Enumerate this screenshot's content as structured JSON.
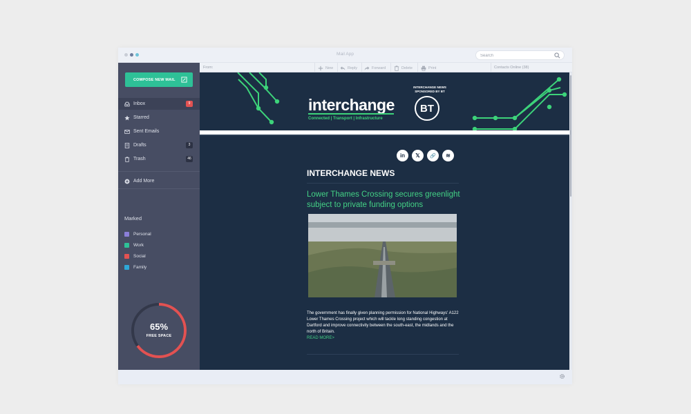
{
  "window": {
    "title": "Mail App",
    "dot_colors": [
      "#c9cdd6",
      "#6e7c9c",
      "#6fc3d9"
    ]
  },
  "search": {
    "placeholder": "Search"
  },
  "sidebar": {
    "compose_label": "COMPOSE NEW MAIL",
    "items": [
      {
        "label": "Inbox",
        "icon": "inbox-icon",
        "badge": "9",
        "badge_color": "#e25252",
        "active": true
      },
      {
        "label": "Starred",
        "icon": "star-icon",
        "badge": "",
        "active": false
      },
      {
        "label": "Sent Emails",
        "icon": "envelope-icon",
        "badge": "",
        "active": false
      },
      {
        "label": "Drafts",
        "icon": "draft-icon",
        "badge": "3",
        "badge_color": "#2d3244",
        "active": false
      },
      {
        "label": "Trash",
        "icon": "trash-icon",
        "badge": "46",
        "badge_color": "#2d3244",
        "active": false
      }
    ],
    "add_more_label": "Add More",
    "marked_title": "Marked",
    "tags": [
      {
        "label": "Personal",
        "color": "#8b7fd8"
      },
      {
        "label": "Work",
        "color": "#2ec197"
      },
      {
        "label": "Social",
        "color": "#e25252"
      },
      {
        "label": "Family",
        "color": "#2ea8d8"
      }
    ],
    "storage": {
      "percent_label": "65%",
      "free_fraction": 0.65,
      "caption": "FREE SPACE",
      "ring_color": "#e25252"
    }
  },
  "toolbar": {
    "from_label": "From:",
    "buttons": [
      {
        "label": "New",
        "icon": "plus-icon"
      },
      {
        "label": "Reply",
        "icon": "reply-icon"
      },
      {
        "label": "Forward",
        "icon": "forward-icon"
      },
      {
        "label": "Delete",
        "icon": "trash-icon"
      },
      {
        "label": "Print",
        "icon": "print-icon"
      }
    ],
    "contacts_label": "Contacts Online (38)"
  },
  "email": {
    "logo": "interchange",
    "tagline": "Connected | Transport | Infrastructure",
    "sponsor_line1": "INTERCHANGE NEWS",
    "sponsor_line2": "SPONSORED BY BT",
    "bt_logo": "BT",
    "social_icons": [
      "linkedin-icon",
      "x-icon",
      "link-icon",
      "spotify-icon"
    ],
    "social_labels": [
      "in",
      "𝕏",
      "🔗",
      "≋"
    ],
    "section_heading": "INTERCHANGE NEWS",
    "article_title": "Lower Thames Crossing secures greenlight subject to private funding options",
    "article_body": "The government has finally given planning permission for National Highways' A122 Lower Thames Crossing project which will tackle long standing congestion at Dartford and improve connectivity between the south-east, the midlands and the north of Britain.",
    "read_more": "READ MORE>",
    "accent_color": "#43d185",
    "background_color": "#1c2e44"
  }
}
